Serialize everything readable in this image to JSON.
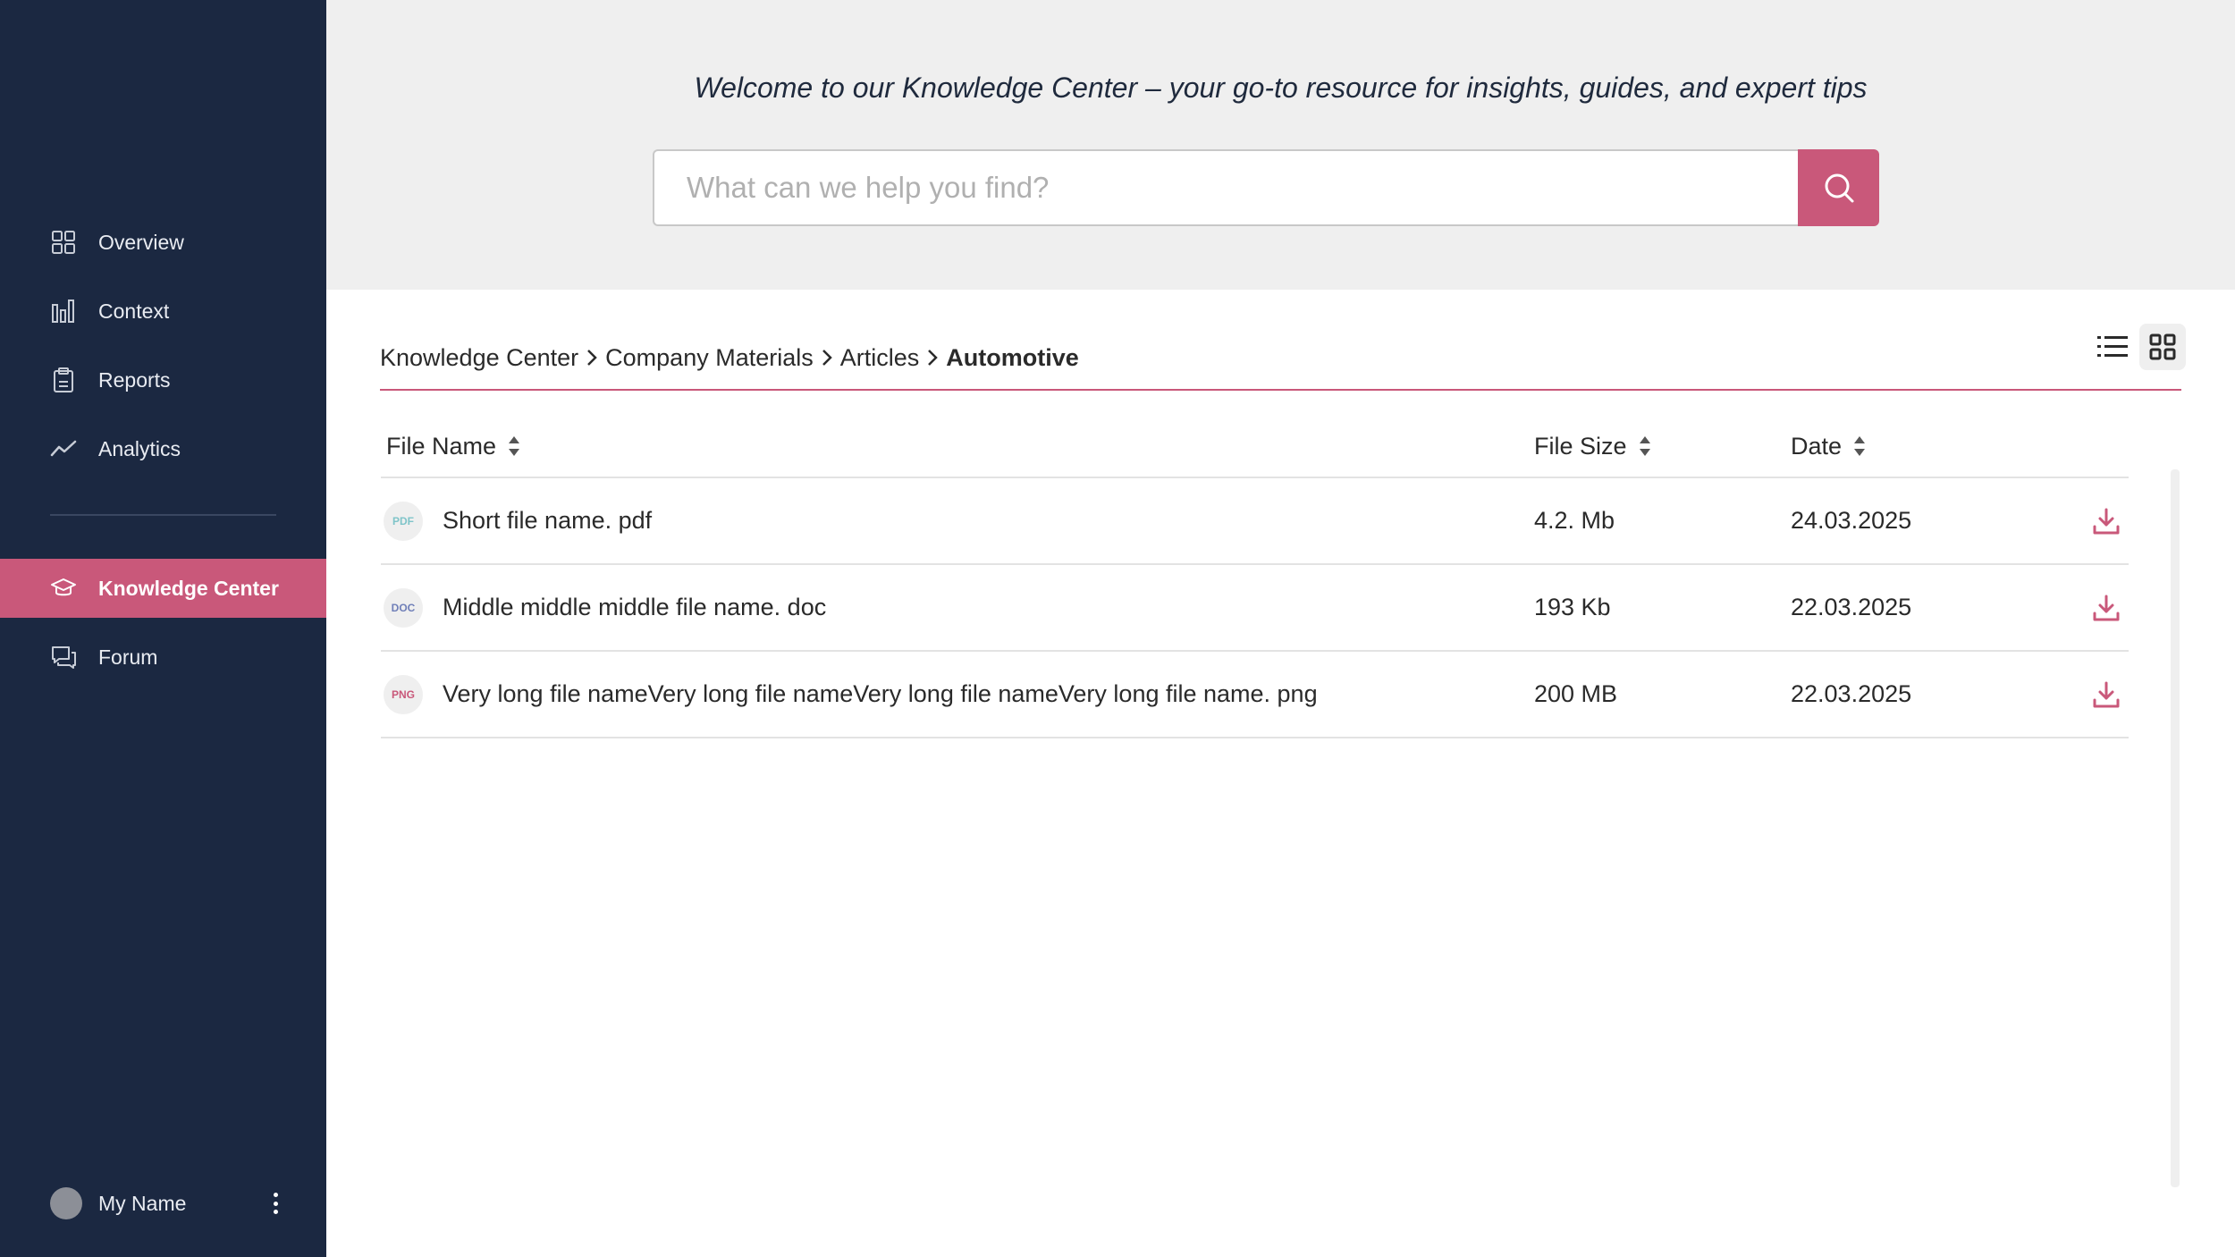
{
  "sidebar": {
    "items": [
      {
        "label": "Overview",
        "icon": "grid-icon"
      },
      {
        "label": "Context",
        "icon": "bar-chart-icon"
      },
      {
        "label": "Reports",
        "icon": "clipboard-icon"
      },
      {
        "label": "Analytics",
        "icon": "trend-line-icon"
      }
    ],
    "items2": [
      {
        "label": "Knowledge Center",
        "icon": "graduation-cap-icon",
        "active": true
      },
      {
        "label": "Forum",
        "icon": "chat-icon"
      }
    ],
    "user": {
      "name": "My Name"
    }
  },
  "header": {
    "welcome": "Welcome to our Knowledge Center – your go-to resource for insights, guides, and expert tips",
    "search_placeholder": "What can we help you find?"
  },
  "breadcrumb": [
    "Knowledge Center",
    "Company Materials",
    "Articles",
    "Automotive"
  ],
  "table": {
    "columns": {
      "name": "File Name",
      "size": "File Size",
      "date": "Date"
    },
    "rows": [
      {
        "type": "PDF",
        "name": "Short file name. pdf",
        "size": "4.2. Mb",
        "date": "24.03.2025",
        "badge_color": "#7fc4c9"
      },
      {
        "type": "DOC",
        "name": "Middle middle middle file name. doc",
        "size": "193 Kb",
        "date": "22.03.2025",
        "badge_color": "#6f7fb8"
      },
      {
        "type": "PNG",
        "name": "Very long file nameVery long file nameVery long file nameVery long file name. png",
        "size": "200 MB",
        "date": "22.03.2025",
        "badge_color": "#c9587a"
      }
    ]
  },
  "colors": {
    "accent": "#c9587a",
    "sidebar": "#1b2841",
    "header_bg": "#efefef"
  }
}
